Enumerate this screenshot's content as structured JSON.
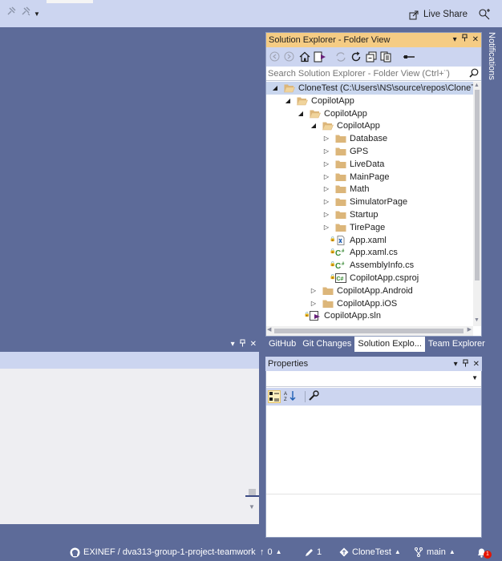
{
  "toolbar": {
    "live_share_label": "Live Share"
  },
  "solution_explorer": {
    "title": "Solution Explorer - Folder View",
    "search_placeholder": "Search Solution Explorer - Folder View (Ctrl+¨)",
    "tree": [
      {
        "label": "CloneTest (C:\\Users\\NS\\source\\repos\\CloneTe",
        "icon": "folder-open-icon",
        "expand": "expanded"
      },
      {
        "label": "CopilotApp",
        "icon": "folder-open-icon",
        "expand": "expanded"
      },
      {
        "label": "CopilotApp",
        "icon": "folder-open-icon",
        "expand": "expanded"
      },
      {
        "label": "CopilotApp",
        "icon": "folder-open-icon",
        "expand": "expanded"
      },
      {
        "label": "Database",
        "icon": "folder-icon",
        "expand": "collapsed"
      },
      {
        "label": "GPS",
        "icon": "folder-icon",
        "expand": "collapsed"
      },
      {
        "label": "LiveData",
        "icon": "folder-icon",
        "expand": "collapsed"
      },
      {
        "label": "MainPage",
        "icon": "folder-icon",
        "expand": "collapsed"
      },
      {
        "label": "Math",
        "icon": "folder-icon",
        "expand": "collapsed"
      },
      {
        "label": "SimulatorPage",
        "icon": "folder-icon",
        "expand": "collapsed"
      },
      {
        "label": "Startup",
        "icon": "folder-icon",
        "expand": "collapsed"
      },
      {
        "label": "TirePage",
        "icon": "folder-icon",
        "expand": "collapsed"
      },
      {
        "label": "App.xaml",
        "icon": "xaml-file-icon",
        "expand": "none"
      },
      {
        "label": "App.xaml.cs",
        "icon": "csharp-file-icon",
        "expand": "none"
      },
      {
        "label": "AssemblyInfo.cs",
        "icon": "csharp-file-icon",
        "expand": "none"
      },
      {
        "label": "CopilotApp.csproj",
        "icon": "csproj-file-icon",
        "expand": "none"
      },
      {
        "label": "CopilotApp.Android",
        "icon": "folder-icon",
        "expand": "collapsed"
      },
      {
        "label": "CopilotApp.iOS",
        "icon": "folder-icon",
        "expand": "collapsed"
      },
      {
        "label": "CopilotApp.sln",
        "icon": "solution-file-icon",
        "expand": "none"
      }
    ],
    "tabs": [
      "GitHub",
      "Git Changes",
      "Solution Explo...",
      "Team Explorer"
    ],
    "active_tab": "Solution Explo..."
  },
  "notifications": {
    "label": "Notifications"
  },
  "properties": {
    "title": "Properties"
  },
  "status_bar": {
    "repo": "EXINEF / dva313-group-1-project-teamwork",
    "push_count": "0",
    "edits_count": "1",
    "solution": "CloneTest",
    "branch": "main",
    "notification_count": "1"
  },
  "colors": {
    "accent": "#5d6b99",
    "tool_window_title_active": "#f5cc84",
    "toolbar_bg": "#ccd5f0",
    "folder": "#dcb67a"
  }
}
